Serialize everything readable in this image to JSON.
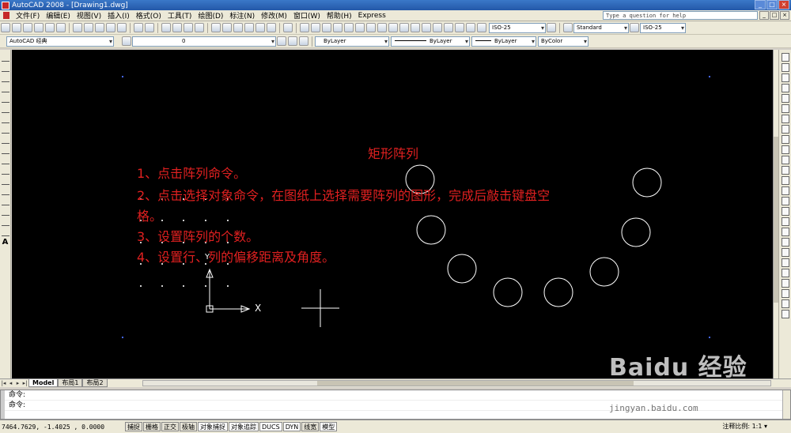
{
  "window": {
    "title": "AutoCAD 2008 - [Drawing1.dwg]"
  },
  "menu": {
    "items": [
      "文件(F)",
      "编辑(E)",
      "视图(V)",
      "插入(I)",
      "格式(O)",
      "工具(T)",
      "绘图(D)",
      "标注(N)",
      "修改(M)",
      "窗口(W)",
      "帮助(H)",
      "Express"
    ],
    "help_placeholder": "Type a question for help"
  },
  "toolbar": {
    "workspace": "AutoCAD 经典",
    "layer_value": "0",
    "dim_style": "ISO-25",
    "text_style": "Standard",
    "table_style": "ISO-25",
    "color": "ByLayer",
    "linetype": "ByLayer",
    "lineweight": "ByLayer",
    "plot_style": "ByColor"
  },
  "drawing": {
    "title": "矩形阵列",
    "steps": [
      "1、点击阵列命令。",
      "2、点击选择对象命令，在图纸上选择需要阵列的图形，完成后敲击键盘空",
      "格。",
      "3、设置阵列的个数。",
      "4、设置行、列的偏移距离及角度。"
    ],
    "ucs_x": "X",
    "ucs_y": "Y"
  },
  "tabs": [
    "Model",
    "布局1",
    "布局2"
  ],
  "command": {
    "line1": "命令:",
    "line2": "命令:"
  },
  "status": {
    "coords": "7464.7629,  -1.4025 , 0.0000",
    "buttons": [
      "捕捉",
      "栅格",
      "正交",
      "极轴",
      "对象捕捉",
      "对象追踪",
      "DUCS",
      "DYN",
      "线宽",
      "模型"
    ],
    "annotation_scale": "注释比例: 1:1 ▾"
  },
  "watermark": {
    "main": "Baidu 经验",
    "sub": "jingyan.baidu.com"
  },
  "colors": {
    "annotation": "#e02020",
    "canvas": "#000000",
    "circle": "#ffffff"
  }
}
